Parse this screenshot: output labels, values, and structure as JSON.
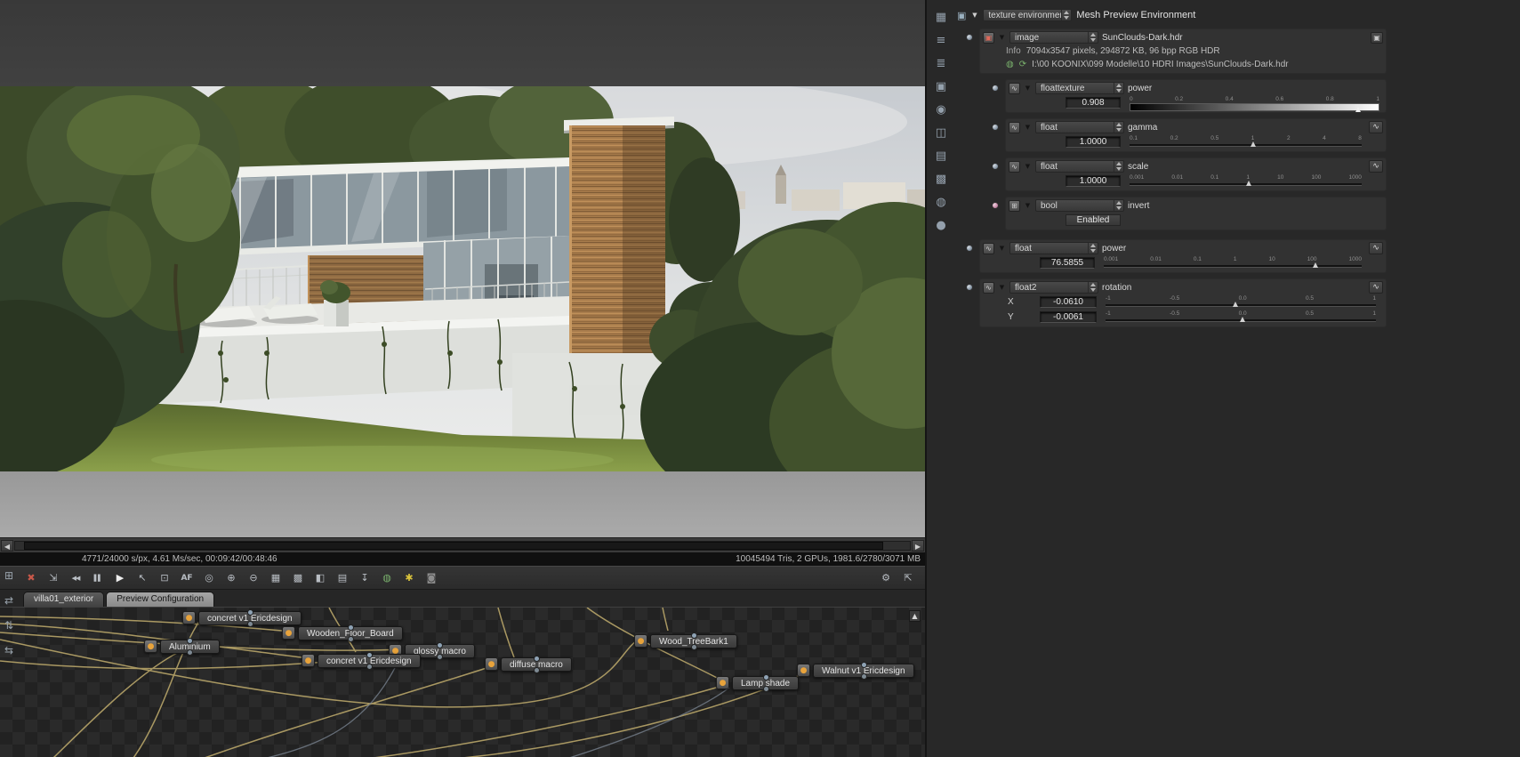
{
  "viewport": {
    "status_left": "4771/24000 s/px, 4.61 Ms/sec, 00:09:42/00:48:46",
    "status_right": "10045494 Tris, 2 GPUs, 1981.6/2780/3071 MB",
    "scroll_left_glyph": "◀",
    "scroll_right_glyph": "▶"
  },
  "toolbar": {
    "items": [
      {
        "name": "restart-render",
        "glyph": "✖"
      },
      {
        "name": "fit-view",
        "glyph": "⇲"
      },
      {
        "name": "rewind",
        "glyph": "◀◀"
      },
      {
        "name": "pause",
        "glyph": "▌▌"
      },
      {
        "name": "play",
        "glyph": "▶"
      },
      {
        "name": "pick-material",
        "glyph": "↖"
      },
      {
        "name": "pick-focus",
        "glyph": "⊡"
      },
      {
        "name": "autofocus",
        "glyph": "AF"
      },
      {
        "name": "white-balance",
        "glyph": "◎"
      },
      {
        "name": "zoom-in",
        "glyph": "⊕"
      },
      {
        "name": "zoom-out",
        "glyph": "⊖"
      },
      {
        "name": "alpha-mode",
        "glyph": "▦"
      },
      {
        "name": "checker-background",
        "glyph": "▩"
      },
      {
        "name": "subsampling",
        "glyph": "◧"
      },
      {
        "name": "copy-image",
        "glyph": "▤"
      },
      {
        "name": "save-image",
        "glyph": "↧"
      },
      {
        "name": "render-region",
        "glyph": "◍"
      },
      {
        "name": "debug-pixel",
        "glyph": "✱"
      },
      {
        "name": "lock-viewport",
        "glyph": "◙"
      },
      {
        "name": "settings",
        "glyph": "⚙"
      },
      {
        "name": "fullscreen",
        "glyph": "⇱"
      }
    ]
  },
  "graph_toolbar": {
    "items": [
      {
        "name": "grid-toggle",
        "glyph": "⊞"
      },
      {
        "name": "swap-ab",
        "glyph": "⇄"
      },
      {
        "name": "sync",
        "glyph": "⇅"
      },
      {
        "name": "pan-mode",
        "glyph": "⇆"
      }
    ]
  },
  "tabs": [
    {
      "label": "villa01_exterior",
      "active": false
    },
    {
      "label": "Preview Configuration",
      "active": true
    }
  ],
  "nodegraph": {
    "scroll_up_glyph": "▲",
    "node_icon_glyph": "●",
    "nodes": [
      {
        "label": "concret v1 Ericdesign"
      },
      {
        "label": "Wooden_Floor_Board"
      },
      {
        "label": "Aluminium"
      },
      {
        "label": "glossy macro"
      },
      {
        "label": "concret v1 Ericdesign"
      },
      {
        "label": "diffuse macro"
      },
      {
        "label": "Wood_TreeBark1"
      },
      {
        "label": "Lamp shade"
      },
      {
        "label": "Walnut v1 Ericdesign"
      }
    ]
  },
  "side_toolbar": {
    "items": [
      {
        "name": "render-targets",
        "glyph": "▦"
      },
      {
        "name": "levels",
        "glyph": "≡"
      },
      {
        "name": "outliner",
        "glyph": "≣"
      },
      {
        "name": "texture-preview",
        "glyph": "▣"
      },
      {
        "name": "camera-settings",
        "glyph": "◉"
      },
      {
        "name": "environment-settings",
        "glyph": "◫"
      },
      {
        "name": "render-passes",
        "glyph": "▤"
      },
      {
        "name": "imager-settings",
        "glyph": "▩"
      },
      {
        "name": "postfx",
        "glyph": "◍"
      },
      {
        "name": "material-preview",
        "glyph": "●"
      }
    ]
  },
  "inspector": {
    "icons": {
      "window": "▣",
      "expander": "▼",
      "image": "▣",
      "float": "∿",
      "bool": "⊞",
      "curve": "∿",
      "image_button": "▣",
      "green_globe": "◍",
      "green_refresh": "⟳"
    },
    "header": {
      "type": "texture environment",
      "name": "Mesh Preview Environment"
    },
    "image_node": {
      "type": "image",
      "name": "SunClouds-Dark.hdr",
      "info_label": "Info",
      "info": "7094x3547 pixels, 294872 KB, 96 bpp RGB HDR",
      "path": "I:\\00 KOONIX\\099 Modelle\\10 HDRI Images\\SunClouds-Dark.hdr"
    },
    "power_tex": {
      "type": "floattexture",
      "label": "power",
      "value": "0.908",
      "ticks": [
        "0",
        "0.2",
        "0.4",
        "0.6",
        "0.8",
        "1"
      ]
    },
    "gamma": {
      "type": "float",
      "label": "gamma",
      "value": "1.0000",
      "ticks": [
        "0.1",
        "0.2",
        "0.5",
        "1",
        "2",
        "4",
        "8"
      ]
    },
    "scale": {
      "type": "float",
      "label": "scale",
      "value": "1.0000",
      "ticks": [
        "0.001",
        "0.01",
        "0.1",
        "1",
        "10",
        "100",
        "1000"
      ]
    },
    "invert": {
      "type": "bool",
      "label": "invert",
      "value": "Enabled"
    },
    "power": {
      "type": "float",
      "label": "power",
      "value": "76.5855",
      "ticks": [
        "0.001",
        "0.01",
        "0.1",
        "1",
        "10",
        "100",
        "1000"
      ]
    },
    "rotation": {
      "type": "float2",
      "label": "rotation",
      "x_label": "X",
      "x_value": "-0.0610",
      "y_label": "Y",
      "y_value": "-0.0061",
      "ticks": [
        "-1",
        "-0.5",
        "0.0",
        "0.5",
        "1"
      ]
    }
  }
}
